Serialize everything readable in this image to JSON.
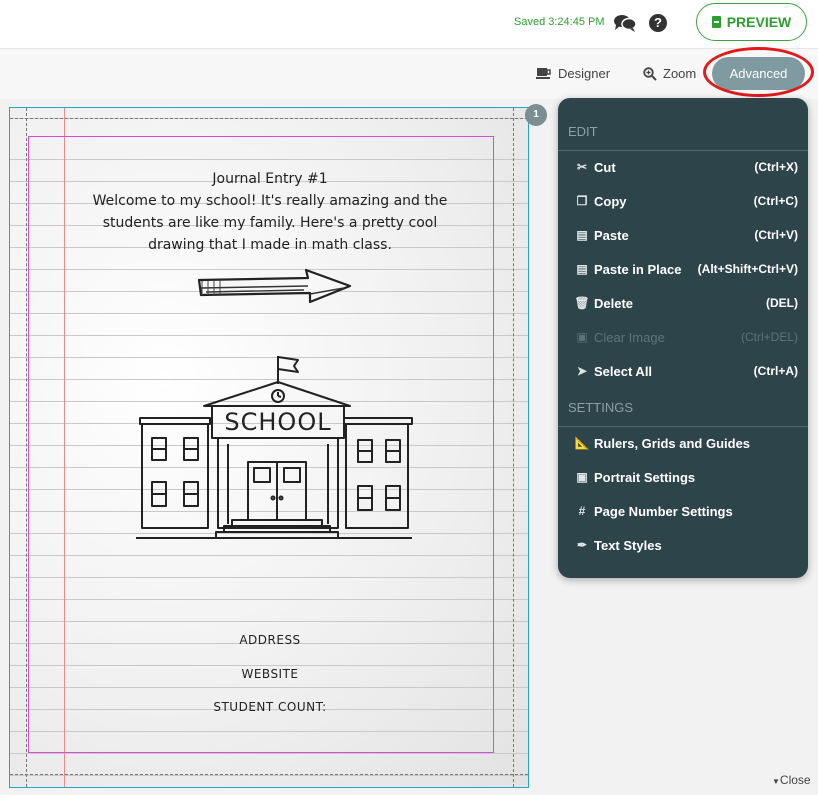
{
  "header": {
    "saved_text": "Saved 3:24:45 PM",
    "preview_label": "PREVIEW",
    "help_symbol": "?"
  },
  "toolbar": {
    "designer_label": "Designer",
    "zoom_label": "Zoom",
    "advanced_label": "Advanced"
  },
  "page": {
    "number": "1",
    "journal_title": "Journal Entry #1",
    "journal_lines": [
      "Welcome to my school! It's really amazing and the",
      "students are like my family. Here's a pretty cool",
      "drawing that I made in math class."
    ],
    "school_sign": "SCHOOL",
    "address_label": "ADDRESS",
    "website_label": "WEBSITE",
    "student_count_label": "STUDENT COUNT:"
  },
  "menu": {
    "edit_title": "EDIT",
    "settings_title": "SETTINGS",
    "edit_items": [
      {
        "label": "Cut",
        "shortcut": "(Ctrl+X)",
        "icon": "scissors-icon"
      },
      {
        "label": "Copy",
        "shortcut": "(Ctrl+C)",
        "icon": "copy-icon"
      },
      {
        "label": "Paste",
        "shortcut": "(Ctrl+V)",
        "icon": "paste-icon"
      },
      {
        "label": "Paste in Place",
        "shortcut": "(Alt+Shift+Ctrl+V)",
        "icon": "paste-in-place-icon"
      },
      {
        "label": "Delete",
        "shortcut": "(DEL)",
        "icon": "trash-icon"
      },
      {
        "label": "Clear Image",
        "shortcut": "(Ctrl+DEL)",
        "icon": "clear-image-icon",
        "disabled": true
      },
      {
        "label": "Select All",
        "shortcut": "(Ctrl+A)",
        "icon": "cursor-icon"
      }
    ],
    "settings_items": [
      {
        "label": "Rulers, Grids and Guides",
        "icon": "ruler-icon"
      },
      {
        "label": "Portrait Settings",
        "icon": "portrait-icon"
      },
      {
        "label": "Page Number Settings",
        "icon": "hash-icon"
      },
      {
        "label": "Text Styles",
        "icon": "pen-icon"
      }
    ]
  },
  "footer": {
    "close_label": "Close"
  },
  "colors": {
    "accent_green": "#2e9e2e",
    "menu_bg": "#2e444b",
    "advanced_bg": "#7f9aa0",
    "highlight_red": "#e01b1b",
    "page_border": "#29a3c8",
    "safe_area": "#d24fd6"
  }
}
